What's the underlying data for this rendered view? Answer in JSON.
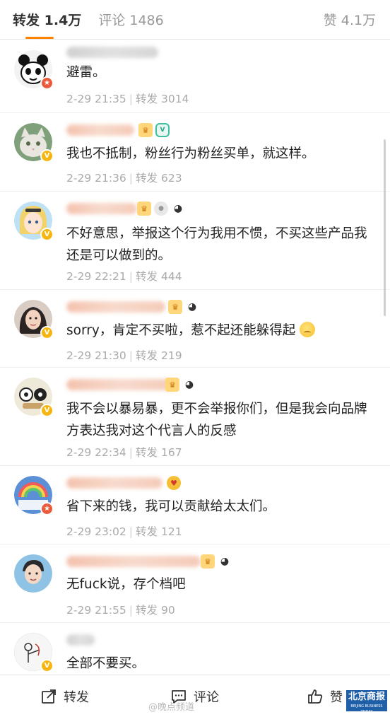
{
  "tabs": {
    "reposts_label": "转发",
    "reposts_count": "1.4万",
    "comments_label": "评论",
    "comments_count": "1486",
    "likes_label": "赞",
    "likes_count": "4.1万"
  },
  "reposts": [
    {
      "text": "避雷。",
      "date": "2-29 21:35",
      "repost_label": "转发",
      "repost_count": "3014",
      "badges": [],
      "verify": "red"
    },
    {
      "text": "我也不抵制，粉丝行为粉丝买单，就这样。",
      "date": "2-29 21:36",
      "repost_label": "转发",
      "repost_count": "623",
      "badges": [
        "crown-icon",
        "shield-icon"
      ],
      "verify": "gold"
    },
    {
      "text": "不好意思，举报这个行为我用不惯，不买这些产品我还是可以做到的。",
      "date": "2-29 22:21",
      "repost_label": "转发",
      "repost_count": "444",
      "badges": [
        "crown-icon",
        "medal-icon",
        "panda-icon"
      ],
      "verify": "gold"
    },
    {
      "text": "sorry，肯定不买啦，惹不起还能躲得起",
      "date": "2-29 21:30",
      "repost_label": "转发",
      "repost_count": "219",
      "badges": [
        "crown-icon",
        "panda-icon"
      ],
      "verify": "gold"
    },
    {
      "text": "我不会以暴易暴，更不会举报你们，但是我会向品牌方表达我对这个代言人的反感",
      "date": "2-29 22:34",
      "repost_label": "转发",
      "repost_count": "167",
      "badges": [
        "crown-icon",
        "panda-icon"
      ],
      "verify": "gold"
    },
    {
      "text": "省下来的钱，我可以贡献给太太们。",
      "date": "2-29 23:02",
      "repost_label": "转发",
      "repost_count": "121",
      "badges": [
        "heart-icon"
      ],
      "verify": "red"
    },
    {
      "text": "无fuck说，存个档吧",
      "date": "2-29 21:55",
      "repost_label": "转发",
      "repost_count": "90",
      "badges": [
        "crown-icon",
        "panda-icon"
      ],
      "verify": "none"
    },
    {
      "text": "全部不要买。",
      "date": "",
      "repost_label": "",
      "repost_count": "",
      "badges": [],
      "verify": "gold"
    }
  ],
  "bottom_bar": {
    "repost_label": "转发",
    "comment_label": "评论",
    "like_label": "赞"
  },
  "watermark": "@晚点频道",
  "logo": {
    "text": "北京商报",
    "sub": "BEIJING BUSINESS TODAY"
  },
  "colors": {
    "accent": "#ff8200",
    "verify_gold": "#f6b50f",
    "verify_red": "#ea5a3b",
    "meta_gray": "#aaaaaa",
    "logo_blue": "#1f5fa8"
  }
}
